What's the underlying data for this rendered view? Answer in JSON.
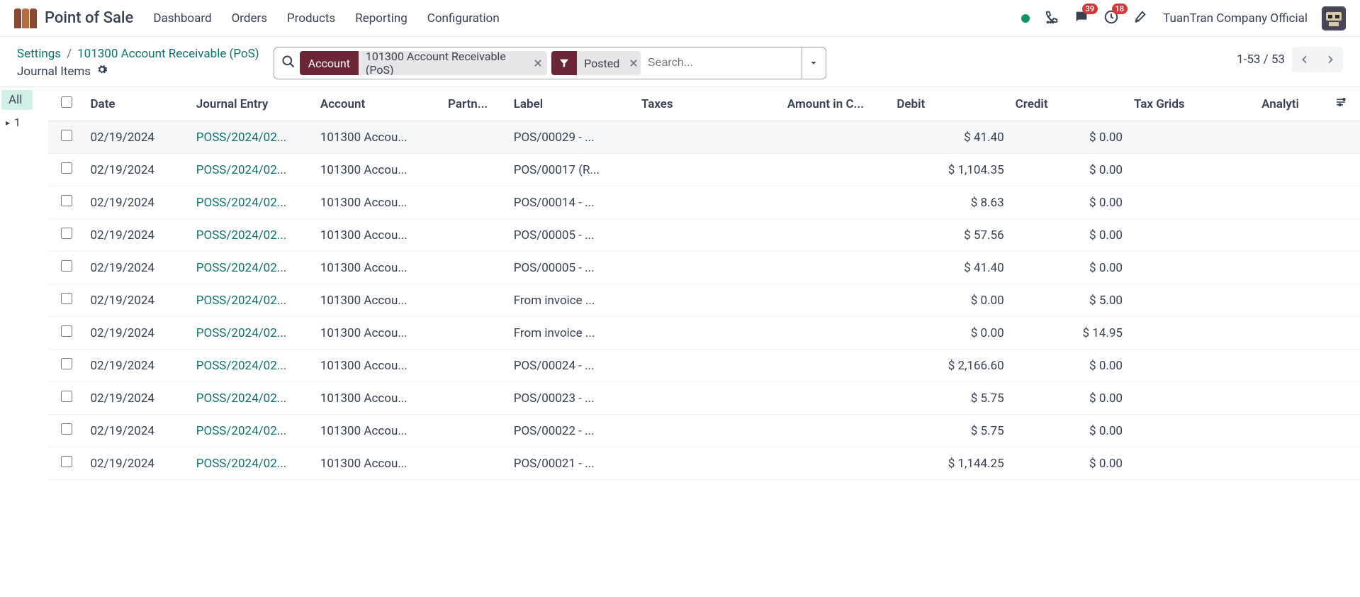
{
  "app": {
    "title": "Point of Sale"
  },
  "nav": [
    "Dashboard",
    "Orders",
    "Products",
    "Reporting",
    "Configuration"
  ],
  "systray": {
    "messages_count": "39",
    "activities_count": "18",
    "company": "TuanTran Company Official"
  },
  "breadcrumb": {
    "root": "Settings",
    "current": "101300 Account Receivable (PoS)",
    "subtitle": "Journal Items"
  },
  "search": {
    "group_tag": "Account",
    "group_value": "101300 Account Receivable (PoS)",
    "filter_value": "Posted",
    "placeholder": "Search..."
  },
  "pager": {
    "text": "1-53 / 53"
  },
  "sidebar": {
    "all_label": "All",
    "group_1": "1"
  },
  "columns": {
    "date": "Date",
    "entry": "Journal Entry",
    "account": "Account",
    "partner": "Partn...",
    "label": "Label",
    "taxes": "Taxes",
    "amount": "Amount in C...",
    "debit": "Debit",
    "credit": "Credit",
    "grids": "Tax Grids",
    "analytic": "Analyti"
  },
  "rows": [
    {
      "date": "02/19/2024",
      "entry": "POSS/2024/02...",
      "account": "101300 Accou...",
      "label": "POS/00029 - ...",
      "debit": "$ 41.40",
      "credit": "$ 0.00"
    },
    {
      "date": "02/19/2024",
      "entry": "POSS/2024/02...",
      "account": "101300 Accou...",
      "label": "POS/00017 (R...",
      "debit": "$ 1,104.35",
      "credit": "$ 0.00"
    },
    {
      "date": "02/19/2024",
      "entry": "POSS/2024/02...",
      "account": "101300 Accou...",
      "label": "POS/00014 - ...",
      "debit": "$ 8.63",
      "credit": "$ 0.00"
    },
    {
      "date": "02/19/2024",
      "entry": "POSS/2024/02...",
      "account": "101300 Accou...",
      "label": "POS/00005 - ...",
      "debit": "$ 57.56",
      "credit": "$ 0.00"
    },
    {
      "date": "02/19/2024",
      "entry": "POSS/2024/02...",
      "account": "101300 Accou...",
      "label": "POS/00005 - ...",
      "debit": "$ 41.40",
      "credit": "$ 0.00"
    },
    {
      "date": "02/19/2024",
      "entry": "POSS/2024/02...",
      "account": "101300 Accou...",
      "label": "From invoice ...",
      "debit": "$ 0.00",
      "credit": "$ 5.00"
    },
    {
      "date": "02/19/2024",
      "entry": "POSS/2024/02...",
      "account": "101300 Accou...",
      "label": "From invoice ...",
      "debit": "$ 0.00",
      "credit": "$ 14.95"
    },
    {
      "date": "02/19/2024",
      "entry": "POSS/2024/02...",
      "account": "101300 Accou...",
      "label": "POS/00024 - ...",
      "debit": "$ 2,166.60",
      "credit": "$ 0.00"
    },
    {
      "date": "02/19/2024",
      "entry": "POSS/2024/02...",
      "account": "101300 Accou...",
      "label": "POS/00023 - ...",
      "debit": "$ 5.75",
      "credit": "$ 0.00"
    },
    {
      "date": "02/19/2024",
      "entry": "POSS/2024/02...",
      "account": "101300 Accou...",
      "label": "POS/00022 - ...",
      "debit": "$ 5.75",
      "credit": "$ 0.00"
    },
    {
      "date": "02/19/2024",
      "entry": "POSS/2024/02...",
      "account": "101300 Accou...",
      "label": "POS/00021 - ...",
      "debit": "$ 1,144.25",
      "credit": "$ 0.00"
    }
  ]
}
